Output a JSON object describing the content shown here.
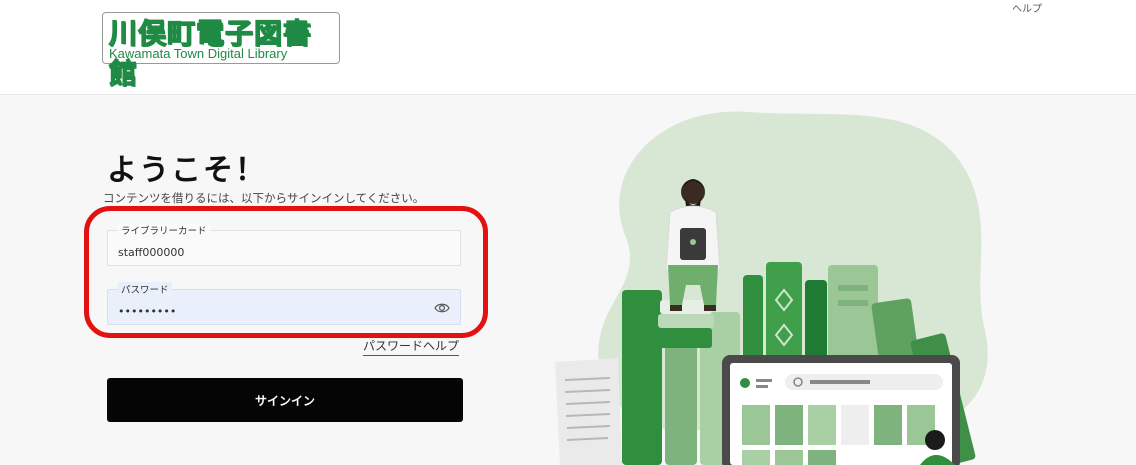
{
  "header": {
    "logo_jp": "川俣町電子図書館",
    "logo_en": "Kawamata Town Digital Library",
    "help_label": "ヘルプ"
  },
  "login": {
    "welcome": "ようこそ！",
    "subtitle": "コンテンツを借りるには、以下からサインインしてください。",
    "card_label": "ライブラリーカード",
    "card_value": "staff000000",
    "password_label": "パスワード",
    "password_value": "staff0000",
    "password_help": "パスワードヘルプ",
    "signin_label": "サインイン"
  },
  "icons": {
    "password_toggle": "eye-icon"
  },
  "colors": {
    "brand_green": "#1e8a44",
    "highlight_red": "#e21212",
    "button_bg": "#050505",
    "password_field_bg": "#e9f0fb"
  }
}
